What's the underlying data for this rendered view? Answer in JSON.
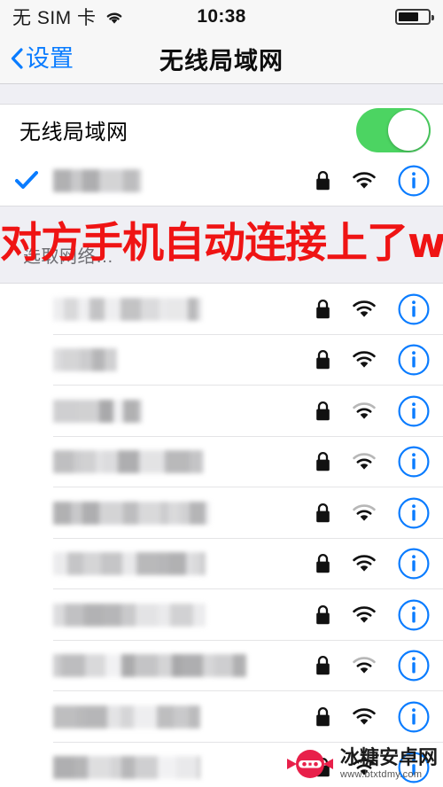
{
  "status_bar": {
    "carrier": "无 SIM 卡",
    "wifi_icon": "wifi-icon",
    "time": "10:38",
    "battery_icon": "battery-icon",
    "battery_level_percent": 70
  },
  "nav_bar": {
    "back_icon": "chevron-left-icon",
    "back_label": "设置",
    "title": "无线局域网"
  },
  "wifi_toggle_row": {
    "label": "无线局域网",
    "toggle_name": "wifi-toggle",
    "toggle_on": true,
    "toggle_on_color": "#4CD462"
  },
  "connected_network": {
    "check_icon": "checkmark-icon",
    "ssid_redacted": true,
    "ssid_width": 100,
    "lock_icon": "lock-icon",
    "wifi_icon": "wifi-signal-icon",
    "signal_bars": 3,
    "info_icon": "info-circle-icon"
  },
  "section_header": {
    "title": "选取网络…"
  },
  "annotation": {
    "text": "对方手机自动连接上了wifi",
    "color": "#EF1414"
  },
  "networks": [
    {
      "ssid_redacted": true,
      "ssid_width": 168,
      "lock_icon": "lock-icon",
      "wifi_icon": "wifi-signal-icon",
      "signal_bars": 3,
      "info_icon": "info-circle-icon"
    },
    {
      "ssid_redacted": true,
      "ssid_width": 72,
      "lock_icon": "lock-icon",
      "wifi_icon": "wifi-signal-icon",
      "signal_bars": 3,
      "info_icon": "info-circle-icon"
    },
    {
      "ssid_redacted": true,
      "ssid_width": 100,
      "lock_icon": "lock-icon",
      "wifi_icon": "wifi-signal-icon",
      "signal_bars": 2,
      "info_icon": "info-circle-icon"
    },
    {
      "ssid_redacted": true,
      "ssid_width": 170,
      "lock_icon": "lock-icon",
      "wifi_icon": "wifi-signal-icon",
      "signal_bars": 2,
      "info_icon": "info-circle-icon"
    },
    {
      "ssid_redacted": true,
      "ssid_width": 177,
      "lock_icon": "lock-icon",
      "wifi_icon": "wifi-signal-icon",
      "signal_bars": 2,
      "info_icon": "info-circle-icon"
    },
    {
      "ssid_redacted": true,
      "ssid_width": 172,
      "lock_icon": "lock-icon",
      "wifi_icon": "wifi-signal-icon",
      "signal_bars": 3,
      "info_icon": "info-circle-icon"
    },
    {
      "ssid_redacted": true,
      "ssid_width": 172,
      "lock_icon": "lock-icon",
      "wifi_icon": "wifi-signal-icon",
      "signal_bars": 3,
      "info_icon": "info-circle-icon"
    },
    {
      "ssid_redacted": true,
      "ssid_width": 218,
      "lock_icon": "lock-icon",
      "wifi_icon": "wifi-signal-icon",
      "signal_bars": 2,
      "info_icon": "info-circle-icon"
    },
    {
      "ssid_redacted": true,
      "ssid_width": 166,
      "lock_icon": "lock-icon",
      "wifi_icon": "wifi-signal-icon",
      "signal_bars": 3,
      "info_icon": "info-circle-icon"
    },
    {
      "ssid_redacted": true,
      "ssid_width": 166,
      "lock_icon": "lock-icon",
      "wifi_icon": "wifi-signal-icon",
      "signal_bars": 3,
      "info_icon": "info-circle-icon"
    }
  ],
  "watermark": {
    "logo_icon": "candy-ninja-logo-icon",
    "title": "冰糖安卓网",
    "url": "www.btxtdmy.com"
  },
  "colors": {
    "ios_blue": "#0A7CFF",
    "toggle_green": "#4CD462",
    "group_background": "#EFEFF4",
    "row_background": "#FFFFFF",
    "separator": "#E2E2E4",
    "annotation_red": "#EF1414"
  }
}
